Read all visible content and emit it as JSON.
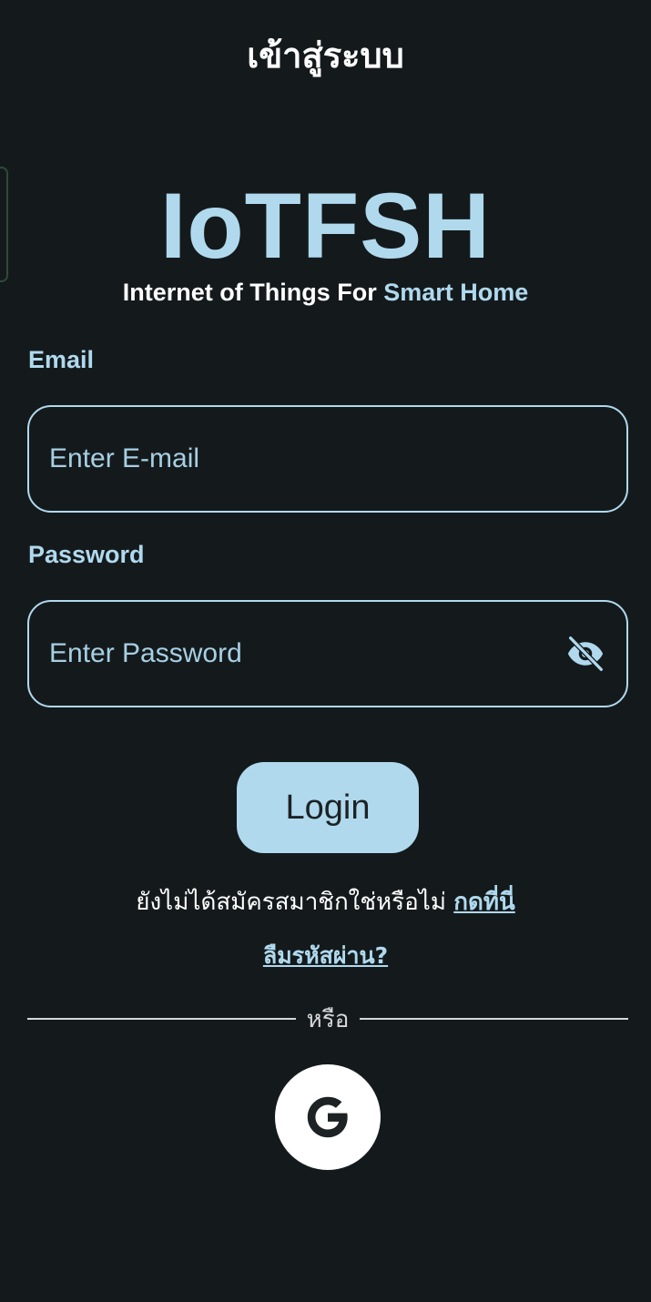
{
  "header": {
    "title": "เข้าสู่ระบบ"
  },
  "logo": {
    "title": "IoTFSH",
    "subtitle_prefix": "Internet of Things For ",
    "subtitle_accent": "Smart Home"
  },
  "form": {
    "email": {
      "label": "Email",
      "placeholder": "Enter E-mail",
      "value": ""
    },
    "password": {
      "label": "Password",
      "placeholder": "Enter Password",
      "value": "",
      "toggle_icon": "eye-off-icon"
    },
    "login_label": "Login"
  },
  "signup": {
    "text": "ยังไม่ได้สมัครสมาชิกใช่หรือไม่ ",
    "link": "กดที่นี่"
  },
  "forgot": {
    "link": "ลืมรหัสผ่าน?"
  },
  "divider": {
    "text": "หรือ"
  },
  "social": {
    "google_letter": "G",
    "icon": "google-icon"
  },
  "colors": {
    "background": "#141a1c",
    "accent": "#b0d9ee",
    "text": "#ffffff"
  }
}
